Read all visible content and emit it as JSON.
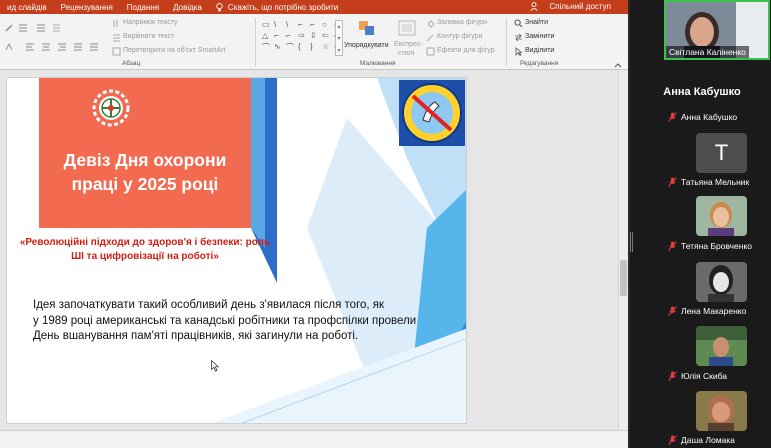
{
  "menu": {
    "items": [
      "ид слайдів",
      "Рецензування",
      "Подання",
      "Довідка"
    ],
    "tell_me": "Скажіть, що потрібно зробити",
    "share": "Спільний доступ"
  },
  "ribbon": {
    "text_direction": "Напрямок тексту",
    "align_text": "Вирівняти текст",
    "convert_smartart": "Перетворити на об'єкт SmartArt",
    "paragraph_label": "Абзац",
    "arrange": "Упорядкувати",
    "quick_styles_line1": "Експрес-",
    "quick_styles_line2": "стилі",
    "shape_fill": "Заливка фігури",
    "shape_outline": "Контур фігури",
    "shape_effects": "Ефекти для фігур",
    "drawing_label": "Малювання",
    "find": "Знайти",
    "replace": "Замінити",
    "select": "Виділити",
    "editing_label": "Редагування"
  },
  "slide": {
    "title": "Девіз Дня охорони праці у 2025 році",
    "subtitle": "«Революційні підходи до здоров'я і безпеки: роль ШІ та цифровізації на роботі»",
    "body_line1": "Ідея започаткувати такий особливий день з'явилася після того, як",
    "body_line2": "у 1989 році американські та канадські робітники та профспілки провели",
    "body_line3": "День вшанування пам'яті працівників, які загинули на роботі."
  },
  "meeting": {
    "speaker_name": "Світлана Каліненко",
    "panel_title": "Анна Кабушко",
    "participants": [
      {
        "name": "Анна Кабушко",
        "initial": ""
      },
      {
        "name": "Татьяна Мельник",
        "initial": "T"
      },
      {
        "name": "Тетяна Бровченко",
        "initial": ""
      },
      {
        "name": "Лена Макаренко",
        "initial": ""
      },
      {
        "name": "Юлія Скиба",
        "initial": ""
      },
      {
        "name": "Даша Ломака",
        "initial": ""
      }
    ]
  },
  "colors": {
    "ppt_accent": "#c43e1c",
    "header_box": "#f26b50",
    "subtitle_red": "#d11d12",
    "speaker_border": "#3ac24a",
    "muted_mic": "#e04040"
  }
}
